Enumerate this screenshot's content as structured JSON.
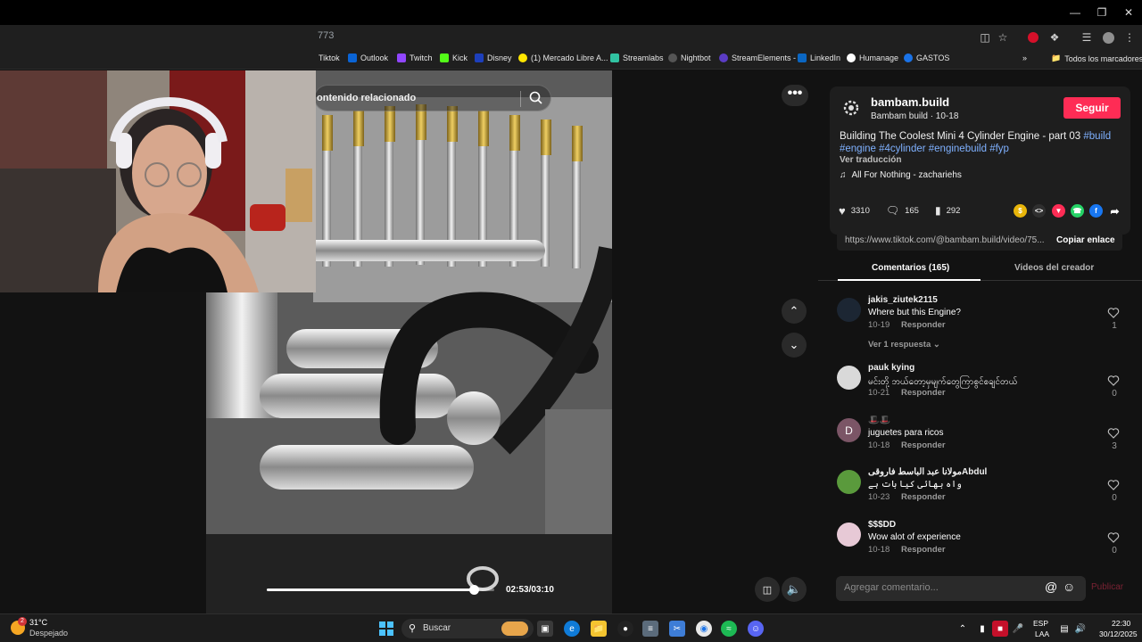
{
  "browser": {
    "url_fragment": "773",
    "bookmarks": [
      {
        "label": "Tiktok",
        "color": "#333333"
      },
      {
        "label": "Outlook",
        "color": "#0a64d6"
      },
      {
        "label": "Twitch",
        "color": "#9146ff"
      },
      {
        "label": "Kick",
        "color": "#53fc18"
      },
      {
        "label": "Disney",
        "color": "#1d3fbb"
      },
      {
        "label": "(1) Mercado Libre A...",
        "color": "#ffe600"
      },
      {
        "label": "Streamlabs",
        "color": "#31c3a2"
      },
      {
        "label": "Nightbot",
        "color": "#222222"
      },
      {
        "label": "StreamElements -",
        "color": "#5b3cc4"
      },
      {
        "label": "LinkedIn",
        "color": "#0a66c2"
      },
      {
        "label": "Humanage",
        "color": "#ffffff"
      },
      {
        "label": "GASTOS",
        "color": "#1a73e8"
      }
    ],
    "all_bookmarks": "Todos los marcadores"
  },
  "video": {
    "search_placeholder": "ontenido relacionado",
    "time": "02:53/03:10",
    "progress": 0.91
  },
  "post": {
    "username": "bambam.build",
    "subname": "Bambam build · 10-18",
    "follow_label": "Seguir",
    "title": "Building The Coolest Mini 4 Cylinder Engine - part 03",
    "tags": [
      "#build",
      "#engine",
      "#4cylinder",
      "#enginebuild",
      "#fyp"
    ],
    "translate": "Ver traducción",
    "music": "All For Nothing - zachariehs",
    "likes": "3310",
    "comments": "165",
    "saves": "292",
    "link": "https://www.tiktok.com/@bambam.build/video/75...",
    "copy_label": "Copiar enlace"
  },
  "tabs": {
    "comments": "Comentarios (165)",
    "creator": "Videos del creador"
  },
  "comments": [
    {
      "user": "jakis_ziutek2115",
      "text": "Where but this Engine?",
      "date": "10-19",
      "reply": "Responder",
      "likes": "1",
      "more": "Ver 1 respuesta",
      "avatar_color": "#1c2633",
      "initial": ""
    },
    {
      "user": "pauk kying",
      "text": "မင်းတို့ ဘယ်တော့မှမျက်တွေကြာစွင်စချင်တယ်",
      "date": "10-21",
      "reply": "Responder",
      "likes": "0",
      "avatar_color": "#d9d9d9",
      "initial": ""
    },
    {
      "user": "🎩🎩",
      "text": "juguetes para ricos",
      "date": "10-18",
      "reply": "Responder",
      "likes": "3",
      "avatar_color": "#7b5566",
      "initial": "D"
    },
    {
      "user": "مولانا عبد الباسط فاروقیAbdul",
      "text": "واہ بھائی کیا بات ہے",
      "date": "10-23",
      "reply": "Responder",
      "likes": "0",
      "avatar_color": "#5a9a3c",
      "initial": ""
    },
    {
      "user": "$$$DD",
      "text": "Wow alot of experience",
      "date": "10-18",
      "reply": "Responder",
      "likes": "0",
      "avatar_color": "#e7c9d6",
      "initial": ""
    }
  ],
  "composer": {
    "placeholder": "Agregar comentario...",
    "at": "@",
    "publish": "Publicar"
  },
  "taskbar": {
    "temp": "31°C",
    "weather": "Despejado",
    "badge": "2",
    "search": "Buscar",
    "lang1": "ESP",
    "lang2": "LAA",
    "time": "22:30",
    "date": "30/12/2025"
  }
}
